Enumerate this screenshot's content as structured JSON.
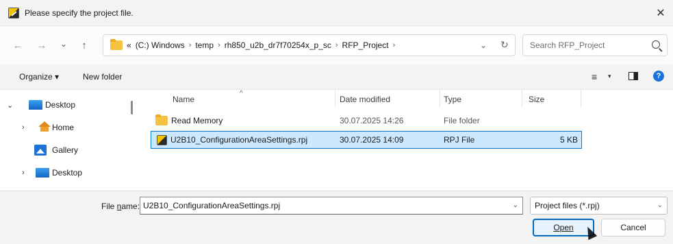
{
  "window": {
    "title": "Please specify the project file.",
    "close_glyph": "✕"
  },
  "nav": {
    "back_glyph": "←",
    "forward_glyph": "→",
    "recent_glyph": "⌄",
    "up_glyph": "↑",
    "overflow": "«",
    "breadcrumbs": [
      "(C:) Windows",
      "temp",
      "rh850_u2b_dr7f70254x_p_sc",
      "RFP_Project"
    ],
    "sep": "›",
    "dropdown_glyph": "⌄",
    "refresh_glyph": "↻"
  },
  "search": {
    "placeholder": "Search RFP_Project"
  },
  "toolbar": {
    "organize_label": "Organize ▾",
    "new_folder_label": "New folder",
    "view_glyph": "≡",
    "view_caret": "▾",
    "help_glyph": "?"
  },
  "sidebar": {
    "items": [
      {
        "label": "Desktop",
        "chevron": "⌄",
        "icon": "desktop-icon"
      },
      {
        "label": "Home",
        "chevron": "›",
        "icon": "home-icon"
      },
      {
        "label": "Gallery",
        "chevron": "",
        "icon": "gallery-icon"
      },
      {
        "label": "Desktop",
        "chevron": "›",
        "icon": "desktop-icon"
      }
    ]
  },
  "files": {
    "columns": [
      "Name",
      "Date modified",
      "Type",
      "Size"
    ],
    "sort_glyph": "^",
    "rows": [
      {
        "name": "Read Memory",
        "date": "30.07.2025 14:26",
        "type": "File folder",
        "size": "",
        "icon": "folder-icon",
        "selected": false
      },
      {
        "name": "U2B10_ConfigurationAreaSettings.rpj",
        "date": "30.07.2025 14:09",
        "type": "RPJ File",
        "size": "5 KB",
        "icon": "rpj-file-icon",
        "selected": true
      }
    ]
  },
  "bottom": {
    "filename_label_pre": "File ",
    "filename_label_u": "n",
    "filename_label_post": "ame:",
    "filename_value": "U2B10_ConfigurationAreaSettings.rpj",
    "filename_caret": "⌄",
    "filetype_value": "Project files (*.rpj)",
    "filetype_caret": "⌄",
    "open_label": "Open",
    "cancel_label": "Cancel"
  },
  "colors": {
    "accent": "#0067c0",
    "selection": "#cce8ff",
    "folder": "#f5c242"
  }
}
